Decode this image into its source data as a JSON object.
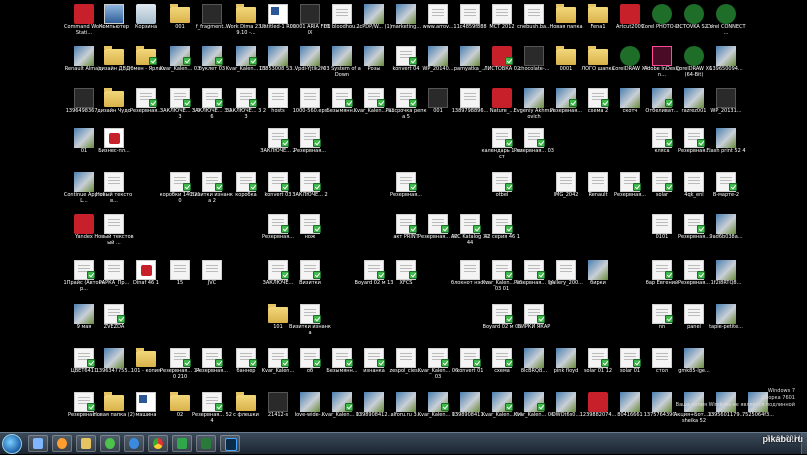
{
  "icons": [
    {
      "label": "Command WorkStati...",
      "kind": "red",
      "badge": false
    },
    {
      "label": "Компьютер",
      "kind": "pc",
      "badge": false
    },
    {
      "label": "Корзина",
      "kind": "bin",
      "badge": false
    },
    {
      "label": "001",
      "kind": "folder",
      "badge": false
    },
    {
      "label": "f_fragment...",
      "kind": "dark",
      "badge": false
    },
    {
      "label": "Work Dima 23.09.10 -...",
      "kind": "folder",
      "badge": false
    },
    {
      "label": "Untitled-1 R01",
      "kind": "word",
      "badge": false
    },
    {
      "label": "00001 ARIA FENIX",
      "kind": "dark",
      "badge": false
    },
    {
      "label": "01 bloodhou...",
      "kind": "doc",
      "badge": false
    },
    {
      "label": "2cPDP/W... (1)",
      "kind": "img",
      "badge": false
    },
    {
      "label": "marketing...",
      "kind": "img",
      "badge": false
    },
    {
      "label": "www.arrov...",
      "kind": "doc",
      "badge": false
    },
    {
      "label": "11c4859f888",
      "kind": "doc",
      "badge": false
    },
    {
      "label": "МСТ 2012",
      "kind": "doc",
      "badge": false
    },
    {
      "label": "cnebush.ba...",
      "kind": "doc",
      "badge": false
    },
    {
      "label": "Новая папка",
      "kind": "folder",
      "badge": false
    },
    {
      "label": "Fena1",
      "kind": "folder",
      "badge": false
    },
    {
      "label": "Artcut2009",
      "kind": "red",
      "badge": false
    },
    {
      "label": "Corel PHOTO-P...",
      "kind": "cdr",
      "badge": false
    },
    {
      "label": "LICTOVKA S2 V",
      "kind": "cdr",
      "badge": false
    },
    {
      "label": "Corel CONNECT ...",
      "kind": "cdr",
      "badge": false
    },
    {
      "label": "Renault Almata",
      "kind": "img",
      "badge": false
    },
    {
      "label": "дизайн ДВД",
      "kind": "folder",
      "badge": false
    },
    {
      "label": "Обмен - Ярлык",
      "kind": "folder",
      "badge": true
    },
    {
      "label": "Kvar_Kalen... 03",
      "kind": "img",
      "badge": true
    },
    {
      "label": "буклет 03",
      "kind": "img",
      "badge": true
    },
    {
      "label": "Kvar_Kalen... 05",
      "kind": "img",
      "badge": true
    },
    {
      "label": "13853008 53...",
      "kind": "img",
      "badge": false
    },
    {
      "label": "Vpdi-Yjtlk2M",
      "kind": "img",
      "badge": false
    },
    {
      "label": "03 System of a Down",
      "kind": "img",
      "badge": false
    },
    {
      "label": "Розы",
      "kind": "img",
      "badge": false
    },
    {
      "label": "konvert 04",
      "kind": "doc",
      "badge": true
    },
    {
      "label": "WP_20140...",
      "kind": "img",
      "badge": false
    },
    {
      "label": "pamyatka_...",
      "kind": "img",
      "badge": false
    },
    {
      "label": "ЛИСТОВКА 02",
      "kind": "red",
      "badge": true
    },
    {
      "label": "chocolate-...",
      "kind": "dark",
      "badge": false
    },
    {
      "label": "0001",
      "kind": "folder",
      "badge": false
    },
    {
      "label": "ЛОГО шапка",
      "kind": "folder",
      "badge": false
    },
    {
      "label": "CorelDRAW X4",
      "kind": "cdr",
      "badge": false
    },
    {
      "label": "Adobe InDesign...",
      "kind": "id",
      "badge": false
    },
    {
      "label": "CorelDRAW X6 (64-Bit)",
      "kind": "cdr",
      "badge": false
    },
    {
      "label": "139650094...",
      "kind": "img",
      "badge": false
    },
    {
      "label": "1396498367...",
      "kind": "dark",
      "badge": false
    },
    {
      "label": "дизайн Чудо",
      "kind": "folder",
      "badge": false
    },
    {
      "label": "Резервная...",
      "kind": "doc",
      "badge": true
    },
    {
      "label": "ЗАКЛЮЧЕ... 3 13",
      "kind": "doc",
      "badge": true
    },
    {
      "label": "ЗАКЛЮЧЕ... 3 16",
      "kind": "doc",
      "badge": true
    },
    {
      "label": "ЗАКЛЮЧЕ... 3 23",
      "kind": "doc",
      "badge": true
    },
    {
      "label": "hosts",
      "kind": "doc",
      "badge": false
    },
    {
      "label": "1000-560.eps",
      "kind": "doc",
      "badge": false
    },
    {
      "label": "Безымянн...",
      "kind": "doc",
      "badge": true
    },
    {
      "label": "Kvar_Kalen... 03",
      "kind": "doc",
      "badge": true
    },
    {
      "label": "Рассрочка репка 5",
      "kind": "doc",
      "badge": true
    },
    {
      "label": "001",
      "kind": "dark",
      "badge": false
    },
    {
      "label": "1389798896...",
      "kind": "doc",
      "badge": false
    },
    {
      "label": "Nature_...",
      "kind": "red",
      "badge": false
    },
    {
      "label": "Evgeniy Akhmatovich",
      "kind": "img",
      "badge": false
    },
    {
      "label": "Резервная...",
      "kind": "img",
      "badge": true
    },
    {
      "label": "схема 2",
      "kind": "doc",
      "badge": true
    },
    {
      "label": "скотч",
      "kind": "img",
      "badge": false
    },
    {
      "label": "Отбеливат...",
      "kind": "img",
      "badge": true
    },
    {
      "label": "razrez001",
      "kind": "img",
      "badge": false
    },
    {
      "label": "WP_20131...",
      "kind": "dark",
      "badge": false
    },
    {
      "label": "01",
      "kind": "img",
      "badge": false
    },
    {
      "label": "Бизнес-пл...",
      "kind": "pdf",
      "badge": false
    },
    {
      "label": "ЗАКЛЮЧЕ... 2",
      "kind": "doc",
      "badge": true
    },
    {
      "label": "Резервная...",
      "kind": "doc",
      "badge": true
    },
    {
      "label": "календарь 1 лист",
      "kind": "doc",
      "badge": true
    },
    {
      "label": "Резервная... 03",
      "kind": "doc",
      "badge": true
    },
    {
      "label": "кляса",
      "kind": "doc",
      "badge": true
    },
    {
      "label": "Резервная...",
      "kind": "doc",
      "badge": true
    },
    {
      "label": "Flash print 52 4",
      "kind": "img",
      "badge": false
    },
    {
      "label": "Continue App of L...",
      "kind": "img",
      "badge": false
    },
    {
      "label": "Новый текстов...",
      "kind": "doc",
      "badge": false
    },
    {
      "label": "коробки 140 210",
      "kind": "doc",
      "badge": true
    },
    {
      "label": "Визитки изнанка 2",
      "kind": "doc",
      "badge": true
    },
    {
      "label": "коробка",
      "kind": "doc",
      "badge": true
    },
    {
      "label": "konvert 03",
      "kind": "doc",
      "badge": true
    },
    {
      "label": "ЗАКЛЮЧЕ... 2",
      "kind": "doc",
      "badge": true
    },
    {
      "label": "Резервная...",
      "kind": "doc",
      "badge": true
    },
    {
      "label": "otbel",
      "kind": "doc",
      "badge": true
    },
    {
      "label": "IMG_2042",
      "kind": "doc",
      "badge": false
    },
    {
      "label": "Renault",
      "kind": "doc",
      "badge": false
    },
    {
      "label": "Резервная...",
      "kind": "doc",
      "badge": true
    },
    {
      "label": "solar",
      "kind": "doc",
      "badge": true
    },
    {
      "label": "4qk_enl",
      "kind": "doc",
      "badge": false
    },
    {
      "label": "В-марте-2",
      "kind": "doc",
      "badge": true
    },
    {
      "label": "Yandex",
      "kind": "red",
      "badge": false
    },
    {
      "label": "Новый текстовый ...",
      "kind": "doc",
      "badge": false
    },
    {
      "label": "Резервная...",
      "kind": "doc",
      "badge": true
    },
    {
      "label": "нож",
      "kind": "doc",
      "badge": true
    },
    {
      "label": "акт PRINT",
      "kind": "doc",
      "badge": true
    },
    {
      "label": "Резервная... 02",
      "kind": "doc",
      "badge": true
    },
    {
      "label": "APC Katalog 32 44",
      "kind": "doc",
      "badge": true
    },
    {
      "label": "42 серия 46 1",
      "kind": "doc",
      "badge": true
    },
    {
      "label": "0101",
      "kind": "doc",
      "badge": false
    },
    {
      "label": "Резервная...",
      "kind": "doc",
      "badge": true
    },
    {
      "label": "9ad6b038a...",
      "kind": "img",
      "badge": false
    },
    {
      "label": "1Прайс (Автосер...",
      "kind": "doc",
      "badge": true
    },
    {
      "label": "РАРКА_Пр...",
      "kind": "doc",
      "badge": false
    },
    {
      "label": "Dinaf 46 1",
      "kind": "pdf",
      "badge": false
    },
    {
      "label": "15",
      "kind": "doc",
      "badge": false
    },
    {
      "label": "JVC",
      "kind": "doc",
      "badge": false
    },
    {
      "label": "ЗАКЛЮЧЕ...",
      "kind": "doc",
      "badge": true
    },
    {
      "label": "Визитки",
      "kind": "doc",
      "badge": true
    },
    {
      "label": "Boyard 02 м 13",
      "kind": "doc",
      "badge": true
    },
    {
      "label": "XFCS",
      "kind": "doc",
      "badge": true
    },
    {
      "label": "блокнот нэсто",
      "kind": "doc",
      "badge": false
    },
    {
      "label": "Kvar_Kalen... 06 03 01",
      "kind": "doc",
      "badge": true
    },
    {
      "label": "Резервная... 04",
      "kind": "doc",
      "badge": true
    },
    {
      "label": "gallery_200...",
      "kind": "doc",
      "badge": false
    },
    {
      "label": "бирки",
      "kind": "img",
      "badge": false
    },
    {
      "label": "бар Евгений",
      "kind": "doc",
      "badge": true
    },
    {
      "label": "Резервная...",
      "kind": "doc",
      "badge": true
    },
    {
      "label": "1f2i8RTQ8...",
      "kind": "img",
      "badge": false
    },
    {
      "label": "9 мая",
      "kind": "img",
      "badge": false
    },
    {
      "label": "ZVEZDA",
      "kind": "doc",
      "badge": true
    },
    {
      "label": "101",
      "kind": "folder",
      "badge": false
    },
    {
      "label": "Визитки изнанка",
      "kind": "doc",
      "badge": true
    },
    {
      "label": "Boyard 02 м 09",
      "kind": "doc",
      "badge": true
    },
    {
      "label": "БИРКИ ЯКАР",
      "kind": "doc",
      "badge": true
    },
    {
      "label": "nn",
      "kind": "doc",
      "badge": true
    },
    {
      "label": "panel",
      "kind": "doc",
      "badge": false
    },
    {
      "label": "tapie-petite...",
      "kind": "img",
      "badge": false
    },
    {
      "label": "ЦВЕТ6411",
      "kind": "doc",
      "badge": true
    },
    {
      "label": "1396347755...",
      "kind": "img",
      "badge": false
    },
    {
      "label": "101 - копия",
      "kind": "folder",
      "badge": false
    },
    {
      "label": "Резервная... 140 210",
      "kind": "doc",
      "badge": true
    },
    {
      "label": "Резервная...",
      "kind": "doc",
      "badge": true
    },
    {
      "label": "баннер",
      "kind": "doc",
      "badge": true
    },
    {
      "label": "Kvar_Kalen...",
      "kind": "doc",
      "badge": true
    },
    {
      "label": "об",
      "kind": "doc",
      "badge": true
    },
    {
      "label": "Безымянн...",
      "kind": "doc",
      "badge": true
    },
    {
      "label": "изнанка",
      "kind": "doc",
      "badge": true
    },
    {
      "label": "zespol_cies...",
      "kind": "doc",
      "badge": false
    },
    {
      "label": "Kvar_Kalen... 06 03",
      "kind": "doc",
      "badge": true
    },
    {
      "label": "konvert 01",
      "kind": "doc",
      "badge": true
    },
    {
      "label": "схема",
      "kind": "doc",
      "badge": true
    },
    {
      "label": "8lcBRQB...",
      "kind": "img",
      "badge": false
    },
    {
      "label": "pink floyd",
      "kind": "img",
      "badge": false
    },
    {
      "label": "solar 01 12",
      "kind": "doc",
      "badge": true
    },
    {
      "label": "solar 01",
      "kind": "doc",
      "badge": true
    },
    {
      "label": "стол",
      "kind": "doc",
      "badge": false
    },
    {
      "label": "gmk85-lge...",
      "kind": "img",
      "badge": false
    },
    {
      "label": "Резервная...",
      "kind": "doc",
      "badge": true
    },
    {
      "label": "Новая папка (2)",
      "kind": "folder",
      "badge": false
    },
    {
      "label": "машина",
      "kind": "word",
      "badge": false
    },
    {
      "label": "02",
      "kind": "folder",
      "badge": false
    },
    {
      "label": "Резервная... 52 4",
      "kind": "doc",
      "badge": true
    },
    {
      "label": "с флешки",
      "kind": "folder",
      "badge": false
    },
    {
      "label": "21412-s",
      "kind": "dark",
      "badge": false
    },
    {
      "label": "love-wide-...",
      "kind": "img",
      "badge": false
    },
    {
      "label": "Kvar_Kalen... 02",
      "kind": "img",
      "badge": true
    },
    {
      "label": "1398908412...",
      "kind": "img",
      "badge": false
    },
    {
      "label": "alforu.ru 3...",
      "kind": "img",
      "badge": false
    },
    {
      "label": "Kvar_Kalen... 03",
      "kind": "img",
      "badge": true
    },
    {
      "label": "1398908411...",
      "kind": "img",
      "badge": false
    },
    {
      "label": "Kvar_Kalen... 04",
      "kind": "img",
      "badge": true
    },
    {
      "label": "Kvar_Kalen... 06",
      "kind": "img",
      "badge": true
    },
    {
      "label": "OWOt6s0...",
      "kind": "img",
      "badge": false
    },
    {
      "label": "1239882074...",
      "kind": "red",
      "badge": false
    },
    {
      "label": "80416661",
      "kind": "img",
      "badge": false
    },
    {
      "label": "1375764390...",
      "kind": "img",
      "badge": false
    },
    {
      "label": "Акция+Бот... Lisheika 52",
      "kind": "img",
      "badge": false
    },
    {
      "label": "1395601179...",
      "kind": "img",
      "badge": false
    },
    {
      "label": "7525064f3...",
      "kind": "img",
      "badge": false
    },
    {
      "label": "2-full",
      "kind": "img",
      "badge": false
    },
    {
      "label": "1395269987...",
      "kind": "img",
      "badge": false
    }
  ],
  "taskbar": {
    "apps": [
      "explorer",
      "media",
      "folder",
      "chat",
      "ie",
      "chrome",
      "green-a",
      "green-b",
      "photoshop"
    ],
    "clock_time": "11:04.2014",
    "clock_line2": ""
  },
  "watermark": {
    "line1": "Windows 7",
    "line2": "Сборка 7601",
    "line3": "Ваша копия Windows не является подлинной"
  },
  "site_watermark": "pikabu.ru",
  "colors": {
    "badge": "#3eb84a",
    "taskbar": "#2a3642",
    "desktop": "#000000"
  }
}
